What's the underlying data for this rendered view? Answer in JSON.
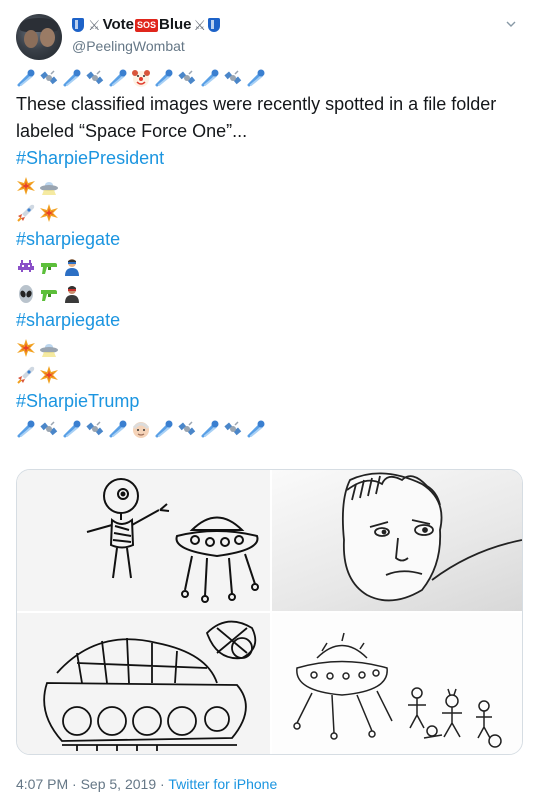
{
  "tweet": {
    "display_name_parts": [
      "Vote",
      "SOS",
      "Blue"
    ],
    "handle": "@PeelingWombat",
    "text": "These classified images were recently spotted in a file folder labeled “Space Force One”...",
    "hashtags": [
      "#SharpiePresident",
      "#sharpiegate",
      "#sharpiegate",
      "#SharpieTrump"
    ],
    "emoji_rows": {
      "top_row": [
        "comet",
        "satellite",
        "comet",
        "satellite",
        "comet",
        "clown-face",
        "comet",
        "satellite",
        "comet",
        "satellite",
        "comet"
      ],
      "row_ufo_1": [
        "collision",
        "flying-saucer"
      ],
      "row_rocket_1": [
        "rocket",
        "collision"
      ],
      "row_invader": [
        "space-invader",
        "water-pistol",
        "superhero"
      ],
      "row_alien": [
        "alien",
        "water-pistol",
        "supervillain"
      ],
      "row_ufo_2": [
        "collision",
        "flying-saucer"
      ],
      "row_rocket_2": [
        "rocket",
        "collision"
      ],
      "bottom_row": [
        "comet",
        "satellite",
        "comet",
        "satellite",
        "comet",
        "older-man",
        "comet",
        "satellite",
        "comet",
        "satellite",
        "comet"
      ]
    },
    "time": "4:07 PM",
    "date": "Sep 5, 2019",
    "source": "Twitter for iPhone",
    "separator": "·"
  },
  "colors": {
    "link": "#1b95e0",
    "secondary_text": "#657786",
    "border": "#d6dde3"
  }
}
